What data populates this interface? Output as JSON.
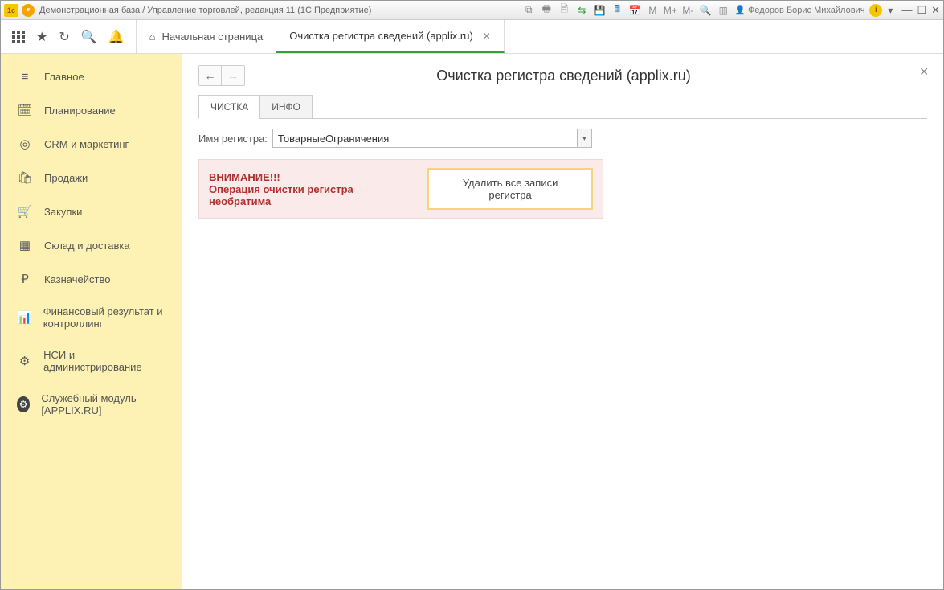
{
  "titlebar": {
    "title": "Демонстрационная база / Управление торговлей, редакция 11 (1С:Предприятие)",
    "mem": {
      "m": "M",
      "mplus": "M+",
      "mminus": "M-"
    },
    "user": "Федоров Борис Михайлович"
  },
  "tabs": {
    "home": "Начальная страница",
    "active": "Очистка регистра сведений (applix.ru)"
  },
  "sidebar": {
    "items": [
      {
        "label": "Главное"
      },
      {
        "label": "Планирование"
      },
      {
        "label": "CRM и маркетинг"
      },
      {
        "label": "Продажи"
      },
      {
        "label": "Закупки"
      },
      {
        "label": "Склад и доставка"
      },
      {
        "label": "Казначейство"
      },
      {
        "label": "Финансовый результат и контроллинг"
      },
      {
        "label": "НСИ и администрирование"
      },
      {
        "label": "Служебный модуль [APPLIX.RU]"
      }
    ]
  },
  "page": {
    "title": "Очистка регистра сведений (applix.ru)",
    "tab_clean": "ЧИСТКА",
    "tab_info": "ИНФО",
    "field_label": "Имя регистра:",
    "field_value": "ТоварныеОграничения",
    "warn_title": "ВНИМАНИЕ!!!",
    "warn_text": "Операция очистки регистра необратима",
    "delete_btn": "Удалить все записи регистра"
  }
}
